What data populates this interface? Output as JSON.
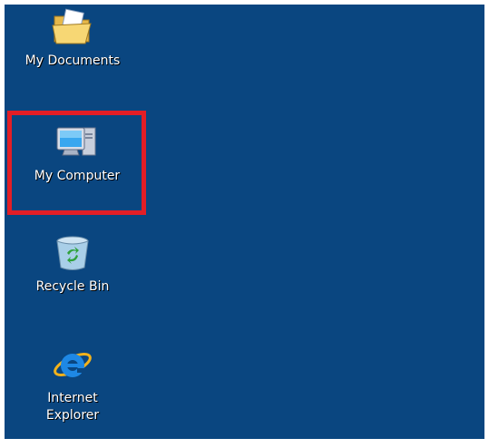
{
  "desktop": {
    "background_color": "#0a4680",
    "highlight_color": "#e31e26",
    "icons": [
      {
        "label": "My Documents",
        "icon": "folder-documents-icon"
      },
      {
        "label": "My Computer",
        "icon": "computer-monitor-icon"
      },
      {
        "label": "Recycle Bin",
        "icon": "recycle-bin-icon"
      },
      {
        "label": "Internet\nExplorer",
        "icon": "internet-explorer-icon"
      }
    ]
  }
}
